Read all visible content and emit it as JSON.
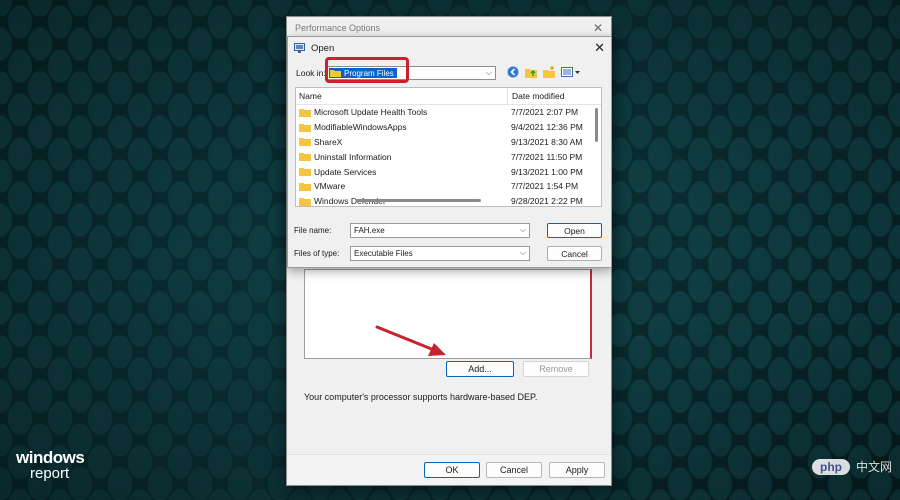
{
  "performance_window": {
    "title": "Performance Options",
    "add_label": "Add...",
    "remove_label": "Remove",
    "dep_message": "Your computer's processor supports hardware-based DEP.",
    "ok_label": "OK",
    "cancel_label": "Cancel",
    "apply_label": "Apply"
  },
  "open_dialog": {
    "title": "Open",
    "look_in_label": "Look in:",
    "look_in_value": "Program Files",
    "columns": {
      "name": "Name",
      "date": "Date modified"
    },
    "files": [
      {
        "name": "Microsoft Update Health Tools",
        "date": "7/7/2021 2:07 PM"
      },
      {
        "name": "ModifiableWindowsApps",
        "date": "9/4/2021 12:36 PM"
      },
      {
        "name": "ShareX",
        "date": "9/13/2021 8:30 AM"
      },
      {
        "name": "Uninstall Information",
        "date": "7/7/2021 11:50 PM"
      },
      {
        "name": "Update Services",
        "date": "9/13/2021 1:00 PM"
      },
      {
        "name": "VMware",
        "date": "7/7/2021 1:54 PM"
      },
      {
        "name": "Windows Defender",
        "date": "9/28/2021 2:22 PM"
      }
    ],
    "file_name_label": "File name:",
    "file_name_value": "FAH.exe",
    "file_type_label": "Files of type:",
    "file_type_value": "Executable Files",
    "open_label": "Open",
    "cancel_label": "Cancel"
  },
  "watermarks": {
    "brand_line1": "windows",
    "brand_line2": "report",
    "php_text": "php",
    "php_cn": "中文网"
  },
  "colors": {
    "background": "#0b3136",
    "accent_blue": "#0067c0",
    "selection": "#0a64c8",
    "highlight_red": "#c8222f",
    "folder_yellow": "#f5c542"
  }
}
